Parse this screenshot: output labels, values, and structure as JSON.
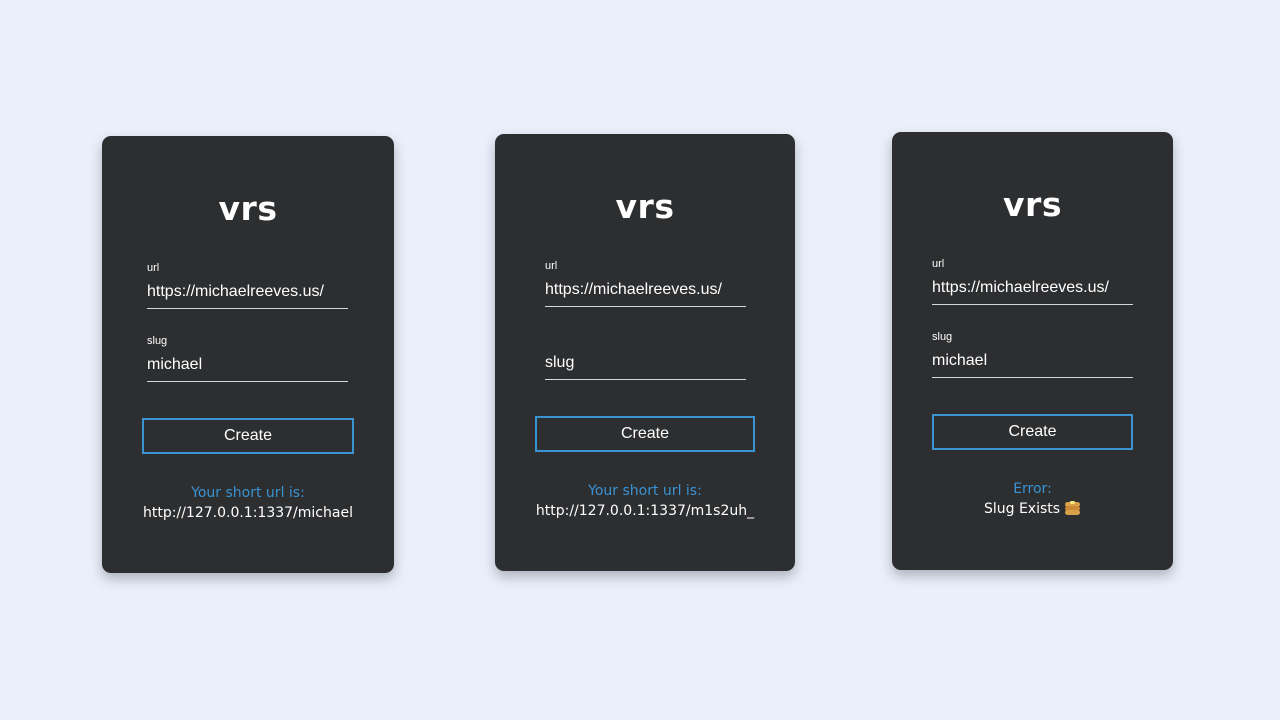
{
  "cards": [
    {
      "title": "vrs",
      "url_label": "url",
      "url_value": "https://michaelreeves.us/",
      "slug_label": "slug",
      "slug_value": "michael",
      "slug_placeholder": "slug",
      "create_label": "Create",
      "result_label": "Your short url is:",
      "result_value": "http://127.0.0.1:1337/michael"
    },
    {
      "title": "vrs",
      "url_label": "url",
      "url_value": "https://michaelreeves.us/",
      "slug_label": "",
      "slug_value": "",
      "slug_placeholder": "slug",
      "create_label": "Create",
      "result_label": "Your short url is:",
      "result_value": "http://127.0.0.1:1337/m1s2uh_"
    },
    {
      "title": "vrs",
      "url_label": "url",
      "url_value": "https://michaelreeves.us/",
      "slug_label": "slug",
      "slug_value": "michael",
      "slug_placeholder": "slug",
      "create_label": "Create",
      "result_label": "Error:",
      "result_value": "Slug Exists",
      "result_icon": "pancake-icon"
    }
  ],
  "colors": {
    "page_background": "#eaeffa",
    "card_background": "#2d2e30",
    "accent": "#3a93d3",
    "text": "#ffffff"
  }
}
